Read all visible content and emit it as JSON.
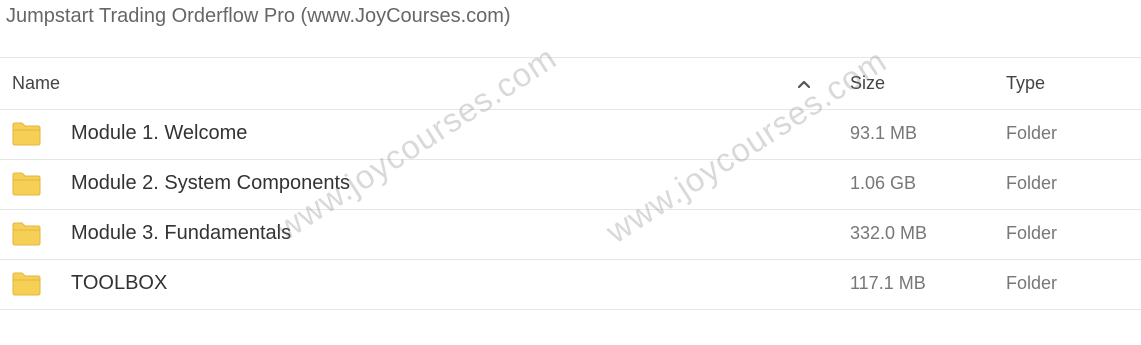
{
  "page": {
    "title": "Jumpstart Trading Orderflow Pro (www.JoyCourses.com)"
  },
  "table": {
    "columns": {
      "name": "Name",
      "size": "Size",
      "type": "Type"
    },
    "sort_icon": "chevron-up-icon",
    "rows": [
      {
        "icon": "folder-icon",
        "name": "Module 1. Welcome",
        "size": "93.1 MB",
        "type": "Folder"
      },
      {
        "icon": "folder-icon",
        "name": "Module 2. System Components",
        "size": "1.06 GB",
        "type": "Folder"
      },
      {
        "icon": "folder-icon",
        "name": "Module 3. Fundamentals",
        "size": "332.0 MB",
        "type": "Folder"
      },
      {
        "icon": "folder-icon",
        "name": "TOOLBOX",
        "size": "117.1 MB",
        "type": "Folder"
      }
    ]
  },
  "watermarks": [
    "www.joycourses.com",
    "www.joycourses.com"
  ],
  "colors": {
    "folder": "#f6cf57",
    "folder_dark": "#e6b53b",
    "divider": "#e6e6e6"
  }
}
